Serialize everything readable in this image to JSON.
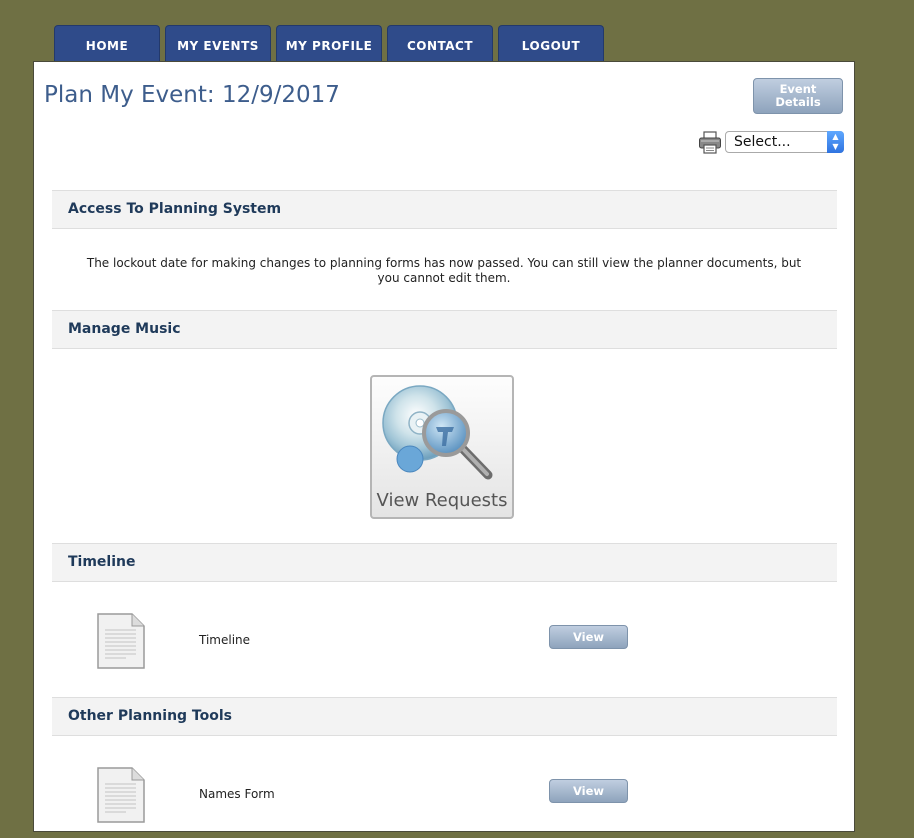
{
  "nav": {
    "tabs": [
      {
        "label": "HOME"
      },
      {
        "label": "MY EVENTS"
      },
      {
        "label": "MY PROFILE"
      },
      {
        "label": "CONTACT"
      },
      {
        "label": "LOGOUT"
      }
    ]
  },
  "header": {
    "title": "Plan My Event: 12/9/2017",
    "event_details_label": "Event Details",
    "select_value": "Select..."
  },
  "sections": {
    "access": {
      "title": "Access To Planning System",
      "text": "The lockout date for making changes to planning forms has now passed. You can still view the planner documents, but you cannot edit them."
    },
    "music": {
      "title": "Manage Music",
      "button_label": "View Requests",
      "icon": "cd-magnifier-icon"
    },
    "timeline": {
      "title": "Timeline",
      "item_label": "Timeline",
      "view_label": "View"
    },
    "other": {
      "title": "Other Planning Tools",
      "item_label": "Names Form",
      "view_label": "View"
    }
  },
  "colors": {
    "background": "#6f7044",
    "tab": "#2f4b8a",
    "title": "#3d5d8c",
    "section_title": "#1f3a5a",
    "button": "#8ea3bc"
  }
}
